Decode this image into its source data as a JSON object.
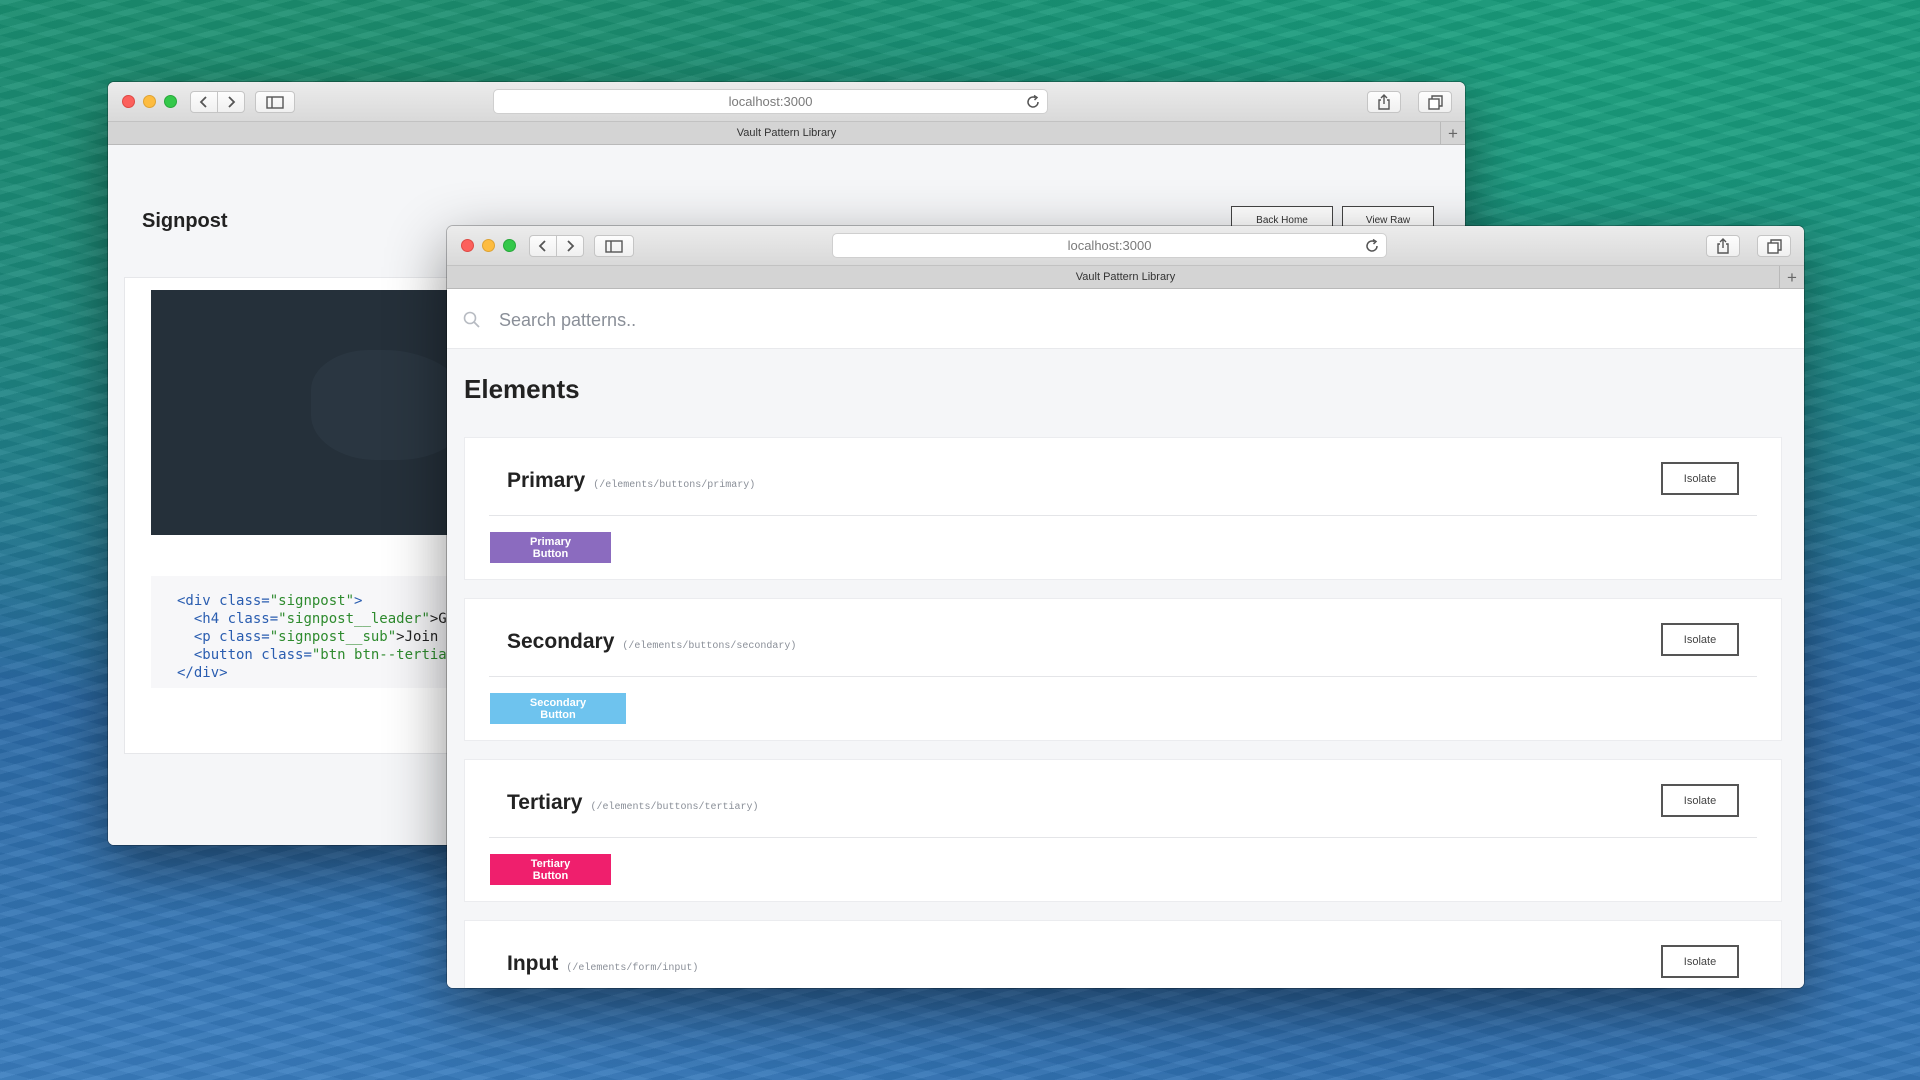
{
  "back_window": {
    "address": "localhost:3000",
    "tab_title": "Vault Pattern Library",
    "page_title": "Signpost",
    "buttons": {
      "back_home": "Back Home",
      "view_raw": "View Raw"
    },
    "code_lines": [
      {
        "tag_open": "<div ",
        "attr": "class=",
        "value": "\"signpost\"",
        "rest": ">"
      },
      {
        "tag_open": "  <h4 ",
        "attr": "class=",
        "value": "\"signpost__leader\"",
        "rest": ">Ge"
      },
      {
        "tag_open": "  <p ",
        "attr": "class=",
        "value": "\"signpost__sub\"",
        "rest": ">Join m"
      },
      {
        "tag_open": "  <button ",
        "attr": "class=",
        "value": "\"btn btn--tertiar",
        "rest": ""
      },
      {
        "tag_open": "</div>",
        "attr": "",
        "value": "",
        "rest": ""
      }
    ]
  },
  "front_window": {
    "address": "localhost:3000",
    "tab_title": "Vault Pattern Library",
    "search": {
      "placeholder": "Search patterns.."
    },
    "section_heading": "Elements",
    "patterns": [
      {
        "name": "Primary",
        "path": "(/elements/buttons/primary)",
        "isolate_label": "Isolate",
        "demo_label": "Primary Button",
        "demo_color": "#8b6bbf"
      },
      {
        "name": "Secondary",
        "path": "(/elements/buttons/secondary)",
        "isolate_label": "Isolate",
        "demo_label": "Secondary Button",
        "demo_color": "#6ec3ee"
      },
      {
        "name": "Tertiary",
        "path": "(/elements/buttons/tertiary)",
        "isolate_label": "Isolate",
        "demo_label": "Tertiary Button",
        "demo_color": "#ef1f6d"
      },
      {
        "name": "Input",
        "path": "(/elements/form/input)",
        "isolate_label": "Isolate"
      }
    ]
  }
}
